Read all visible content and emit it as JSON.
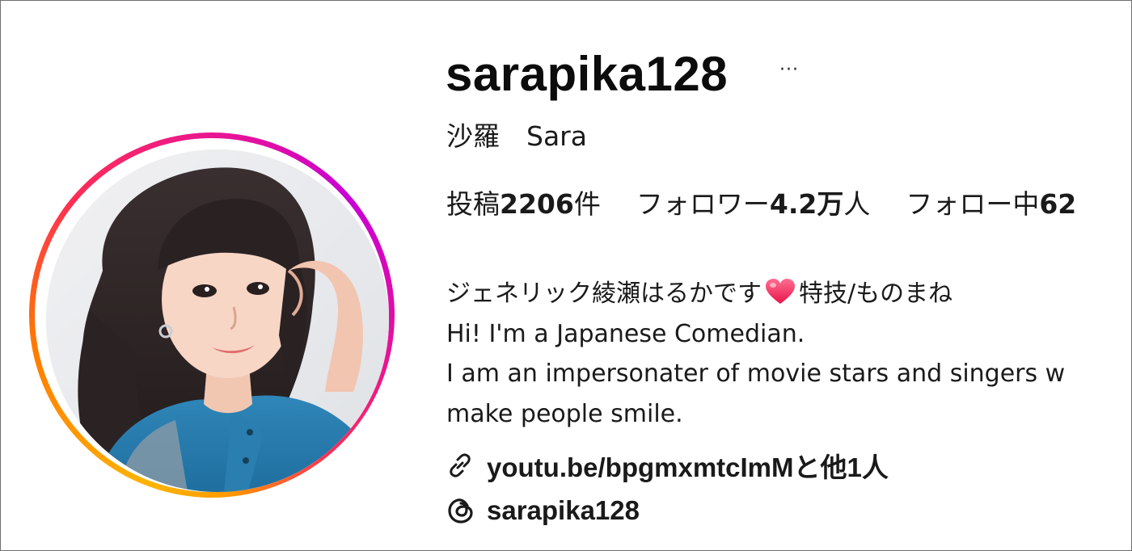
{
  "profile": {
    "username": "sarapika128",
    "more_label": "···",
    "full_name": "沙羅　Sara",
    "stats": [
      {
        "label": "投稿",
        "value": "2206",
        "suffix": "件"
      },
      {
        "label": "フォロワー",
        "value": "4.2万",
        "suffix": "人"
      },
      {
        "label": "フォロー中",
        "value": "62",
        "suffix": ""
      }
    ],
    "bio": {
      "line1_a": "ジェネリック綾瀬はるかです",
      "line1_b": "特技/ものまね",
      "line2": "Hi! I'm a Japanese Comedian.",
      "line3": "I am an impersonater of movie stars and singers w",
      "line4": "make people smile."
    },
    "link_text": "youtu.be/bpgmxmtcImMと他1人",
    "threads_handle": "sarapika128"
  },
  "icons": {
    "avatar": "profile-photo",
    "more": "more-options-icon",
    "heart": "heart-emoji",
    "link": "link-icon",
    "threads": "threads-icon"
  },
  "colors": {
    "ring_start": "#ffb400",
    "ring_mid": "#ff2d55",
    "ring_end": "#c900d6",
    "text": "#1a1a1a",
    "heart": "#ff3b6b"
  }
}
